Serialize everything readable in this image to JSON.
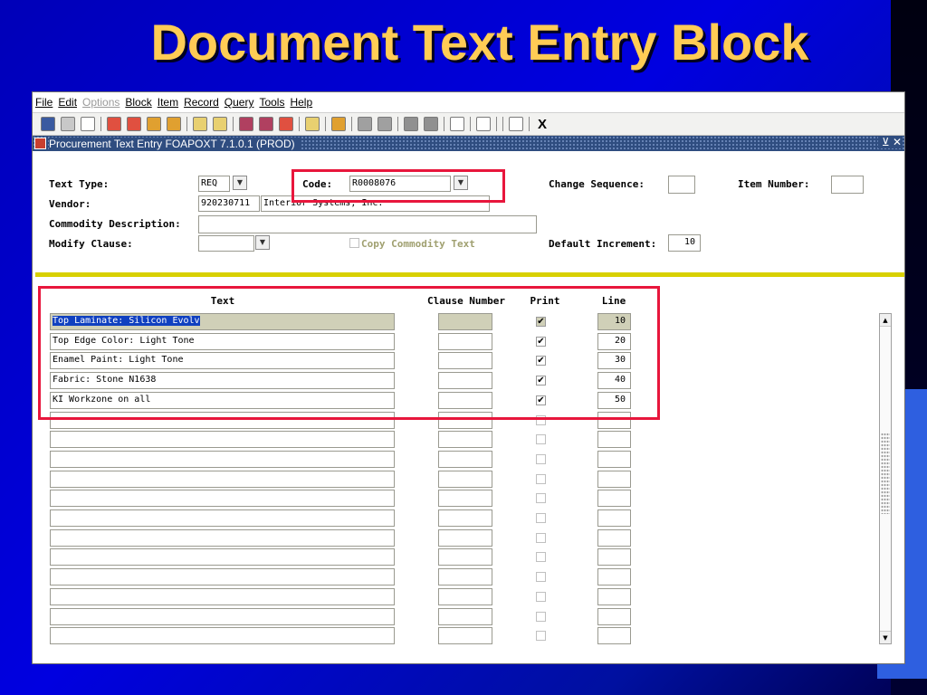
{
  "slide": {
    "title": "Document Text Entry Block"
  },
  "menu": {
    "items": [
      "File",
      "Edit",
      "Options",
      "Block",
      "Item",
      "Record",
      "Query",
      "Tools",
      "Help"
    ],
    "disabled": [
      "Options"
    ]
  },
  "toolbar": {
    "close_label": "X"
  },
  "window": {
    "title": "Procurement Text Entry  FOAPOXT  7.1.0.1  (PROD)",
    "controls": "⊻ ✕"
  },
  "header": {
    "text_type_label": "Text Type:",
    "text_type_value": "REQ",
    "code_label": "Code:",
    "code_value": "R0008076",
    "change_sequence_label": "Change Sequence:",
    "change_sequence_value": "",
    "item_number_label": "Item Number:",
    "item_number_value": "",
    "vendor_label": "Vendor:",
    "vendor_id": "920230711",
    "vendor_name": "Interior Systems, Inc.",
    "commodity_label": "Commodity Description:",
    "commodity_value": "",
    "modify_label": "Modify Clause:",
    "modify_value": "",
    "copy_label": "Copy Commodity Text",
    "default_increment_label": "Default Increment:",
    "default_increment_value": "10"
  },
  "table": {
    "columns": {
      "text": "Text",
      "clause": "Clause Number",
      "print": "Print",
      "line": "Line"
    },
    "rows": [
      {
        "text": "Top Laminate: Silicon Evolv",
        "clause": "",
        "print": true,
        "line": "10"
      },
      {
        "text": "Top Edge Color: Light Tone",
        "clause": "",
        "print": true,
        "line": "20"
      },
      {
        "text": "Enamel Paint: Light Tone",
        "clause": "",
        "print": true,
        "line": "30"
      },
      {
        "text": "Fabric: Stone N1638",
        "clause": "",
        "print": true,
        "line": "40"
      },
      {
        "text": "KI Workzone on all",
        "clause": "",
        "print": true,
        "line": "50"
      },
      {
        "text": "",
        "clause": "",
        "print": false,
        "line": ""
      },
      {
        "text": "",
        "clause": "",
        "print": false,
        "line": ""
      },
      {
        "text": "",
        "clause": "",
        "print": false,
        "line": ""
      },
      {
        "text": "",
        "clause": "",
        "print": false,
        "line": ""
      },
      {
        "text": "",
        "clause": "",
        "print": false,
        "line": ""
      },
      {
        "text": "",
        "clause": "",
        "print": false,
        "line": ""
      },
      {
        "text": "",
        "clause": "",
        "print": false,
        "line": ""
      },
      {
        "text": "",
        "clause": "",
        "print": false,
        "line": ""
      },
      {
        "text": "",
        "clause": "",
        "print": false,
        "line": ""
      },
      {
        "text": "",
        "clause": "",
        "print": false,
        "line": ""
      },
      {
        "text": "",
        "clause": "",
        "print": false,
        "line": ""
      },
      {
        "text": "",
        "clause": "",
        "print": false,
        "line": ""
      }
    ]
  },
  "colors": {
    "highlight_box": "#e8163c",
    "title": "#ffcc55",
    "divider": "#d8d000"
  }
}
